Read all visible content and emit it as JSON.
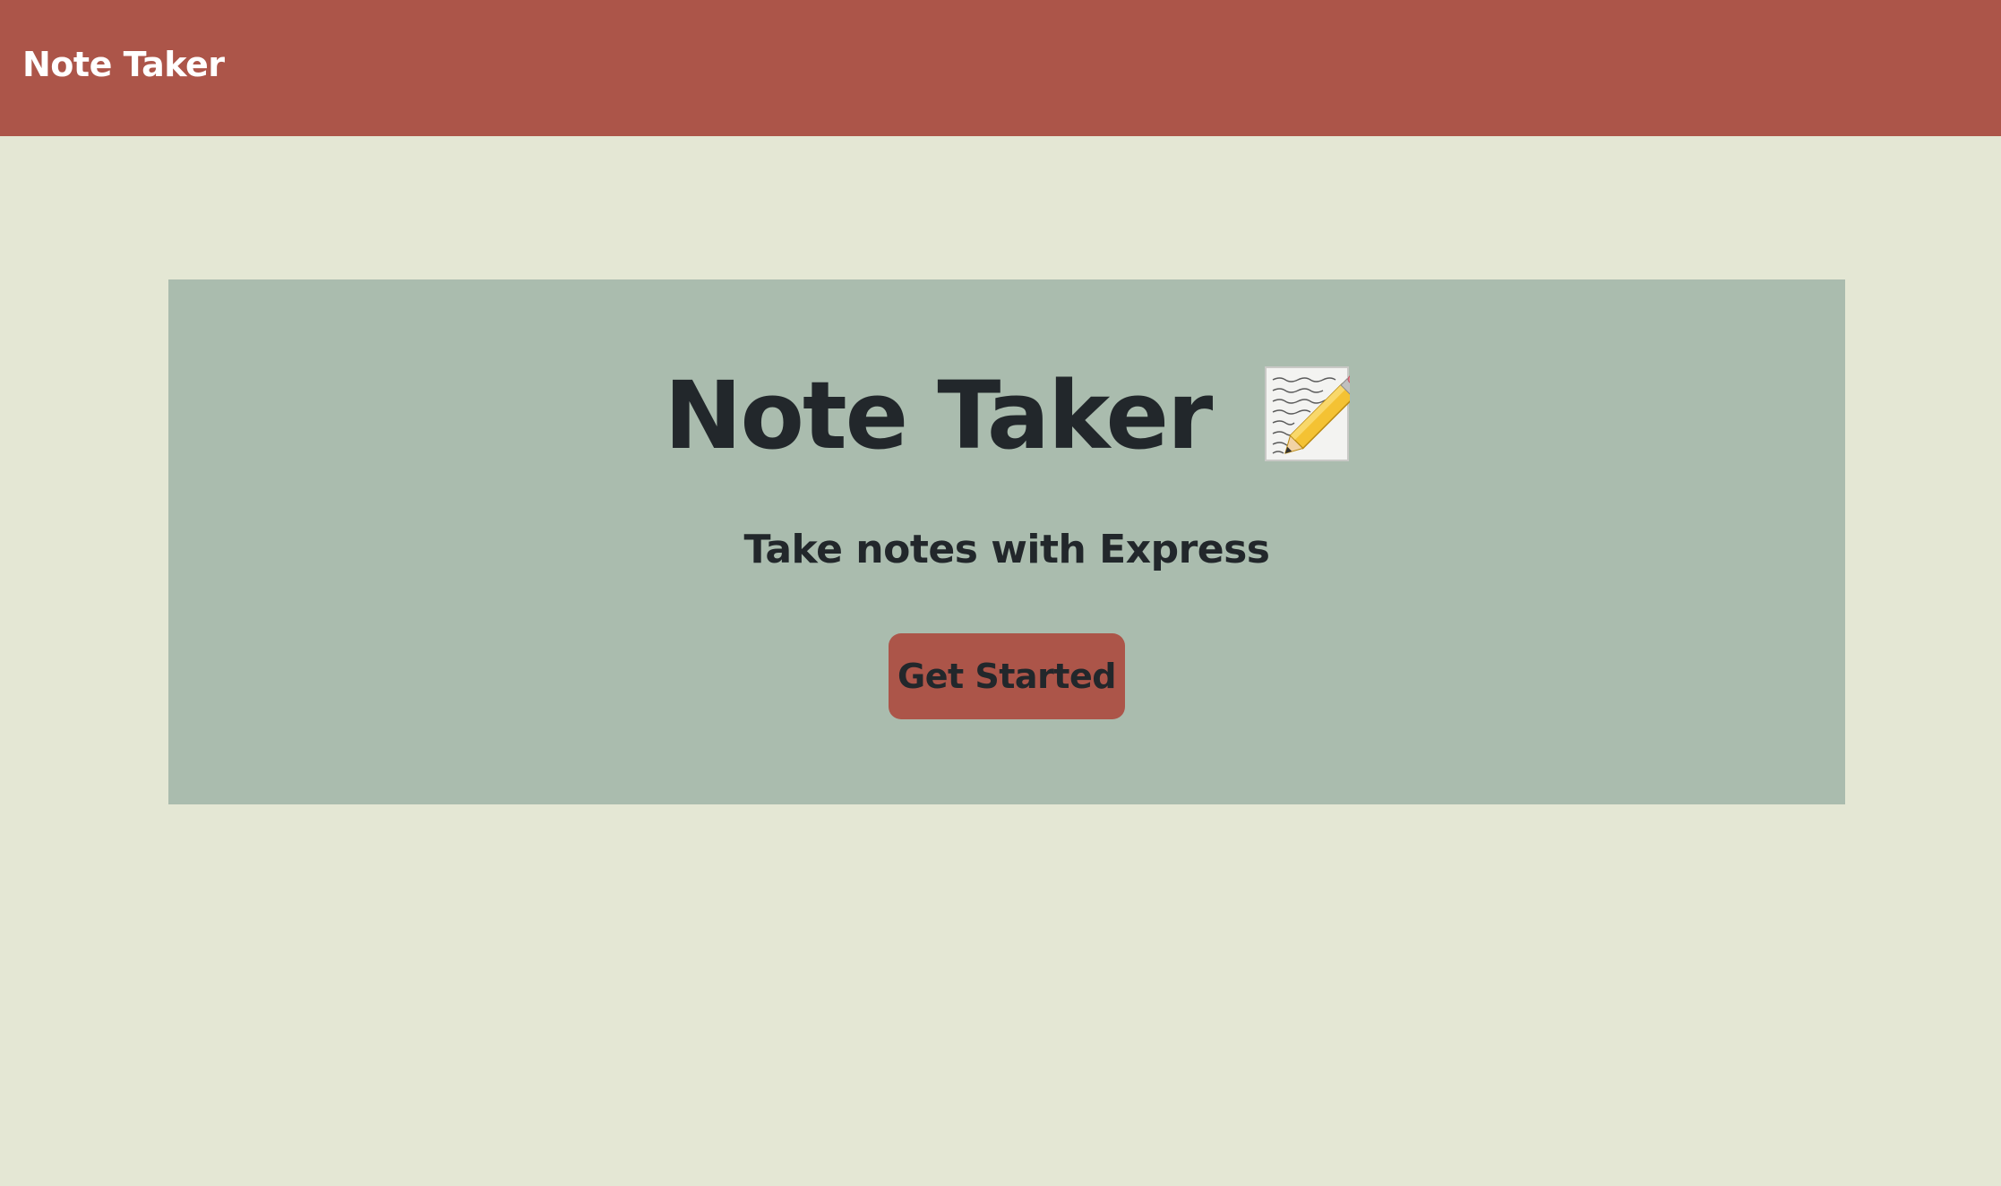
{
  "navbar": {
    "brand": "Note Taker"
  },
  "hero": {
    "title": "Note Taker",
    "emoji_icon": "memo-with-pencil-icon",
    "subtitle": "Take notes with Express",
    "cta_label": "Get Started"
  },
  "colors": {
    "navbar_bg": "#ac5549",
    "page_bg": "#e4e7d4",
    "hero_bg": "#aabcae",
    "button_bg": "#ac5549",
    "text": "#22272b"
  }
}
